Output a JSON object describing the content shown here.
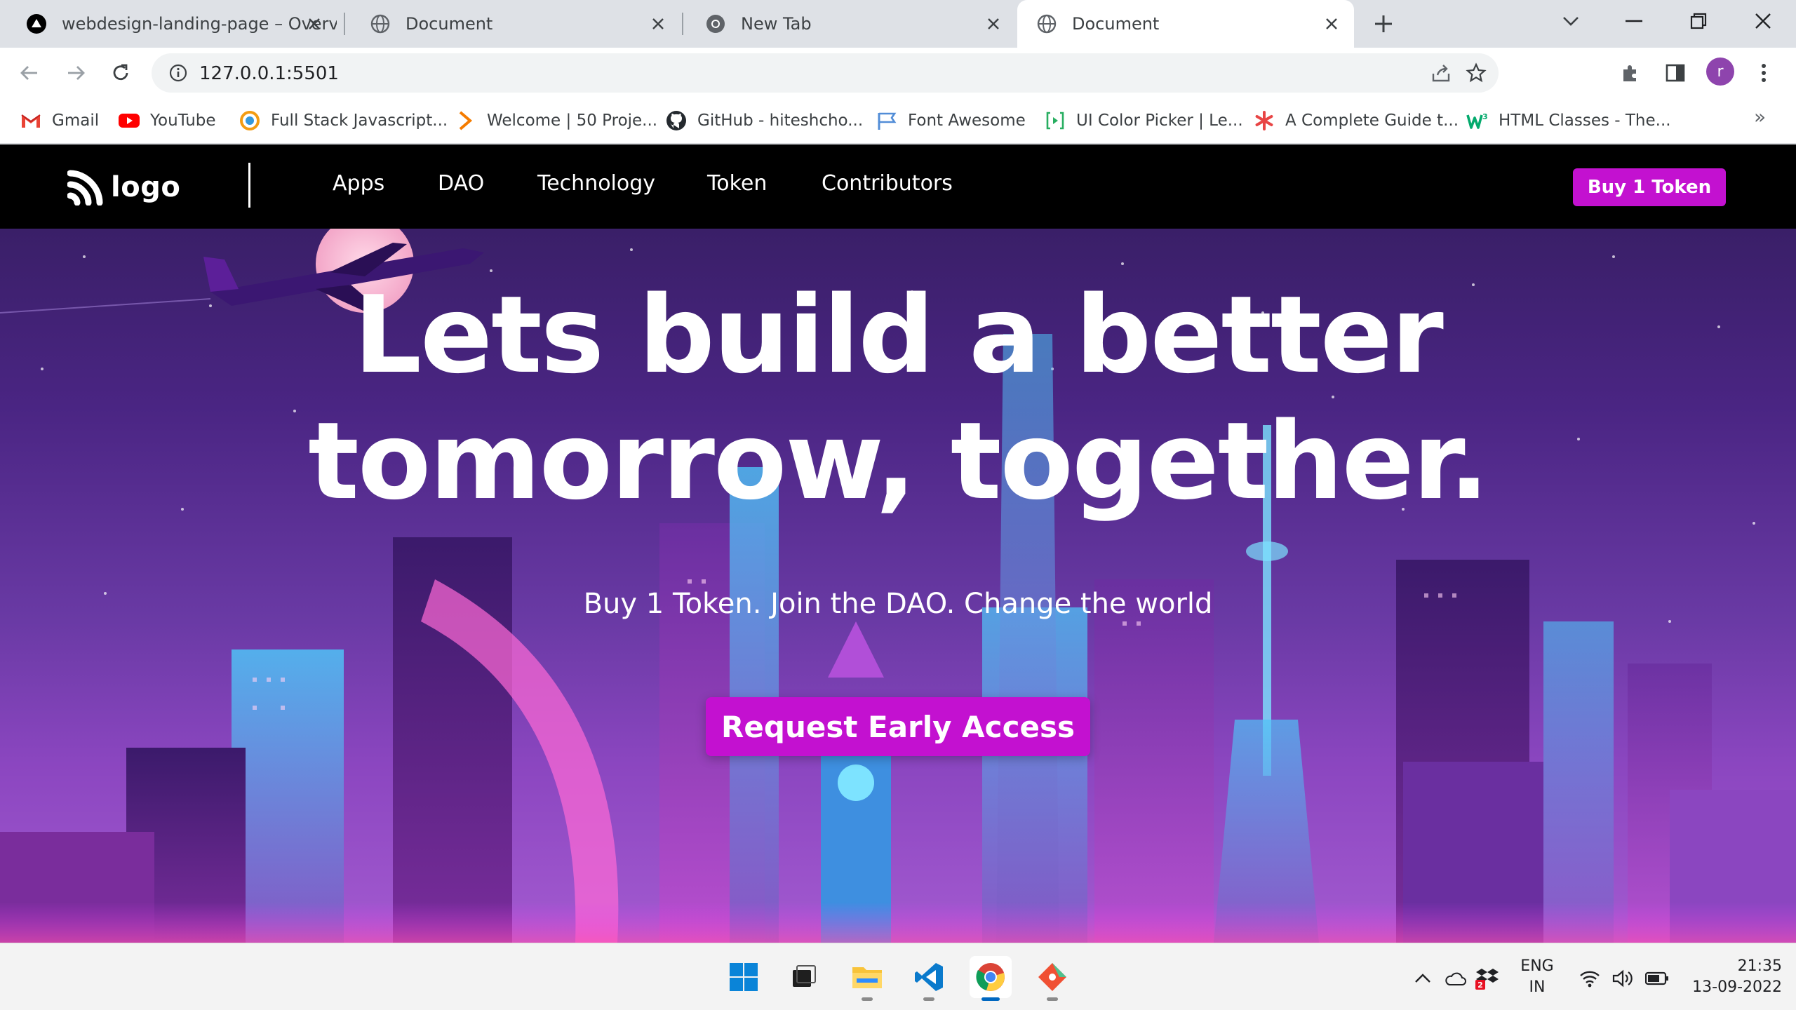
{
  "browser": {
    "tabs": [
      {
        "title": "webdesign-landing-page – Overv",
        "icon": "vercel-icon",
        "active": false
      },
      {
        "title": "Document",
        "icon": "globe-icon",
        "active": false
      },
      {
        "title": "New Tab",
        "icon": "chrome-icon",
        "active": false
      },
      {
        "title": "Document",
        "icon": "globe-icon",
        "active": true
      }
    ],
    "url": "127.0.0.1:5501",
    "profile_initial": "r",
    "bookmarks": [
      {
        "label": "Gmail",
        "icon": "gmail-icon"
      },
      {
        "label": "YouTube",
        "icon": "youtube-icon"
      },
      {
        "label": "Full Stack Javascript...",
        "icon": "fullstack-icon"
      },
      {
        "label": "Welcome | 50 Proje...",
        "icon": "chevron-logo-icon"
      },
      {
        "label": "GitHub - hiteshcho...",
        "icon": "github-icon"
      },
      {
        "label": "Font Awesome",
        "icon": "font-awesome-icon"
      },
      {
        "label": "UI Color Picker | Le...",
        "icon": "ui-color-picker-icon"
      },
      {
        "label": "A Complete Guide t...",
        "icon": "asterisk-icon"
      },
      {
        "label": "HTML Classes - The...",
        "icon": "w3schools-icon"
      }
    ],
    "more_bookmarks": "»"
  },
  "site": {
    "logo_text": "logo",
    "nav_links": [
      "Apps",
      "DAO",
      "Technology",
      "Token",
      "Contributors"
    ],
    "buy_button": "Buy 1 Token",
    "hero_title_line1": "Lets build a better",
    "hero_title_line2": "tomorrow, together.",
    "hero_subtitle": "Buy 1 Token. Join the DAO. Change the world",
    "cta_button": "Request Early Access",
    "colors": {
      "accent": "#c311d0",
      "nav_bg": "#000000"
    }
  },
  "taskbar": {
    "apps": [
      "windows-start-icon",
      "task-view-icon",
      "file-explorer-icon",
      "vscode-icon",
      "chrome-icon",
      "git-icon"
    ],
    "lang_line1": "ENG",
    "lang_line2": "IN",
    "time": "21:35",
    "date": "13-09-2022",
    "notification_badge": "2"
  }
}
